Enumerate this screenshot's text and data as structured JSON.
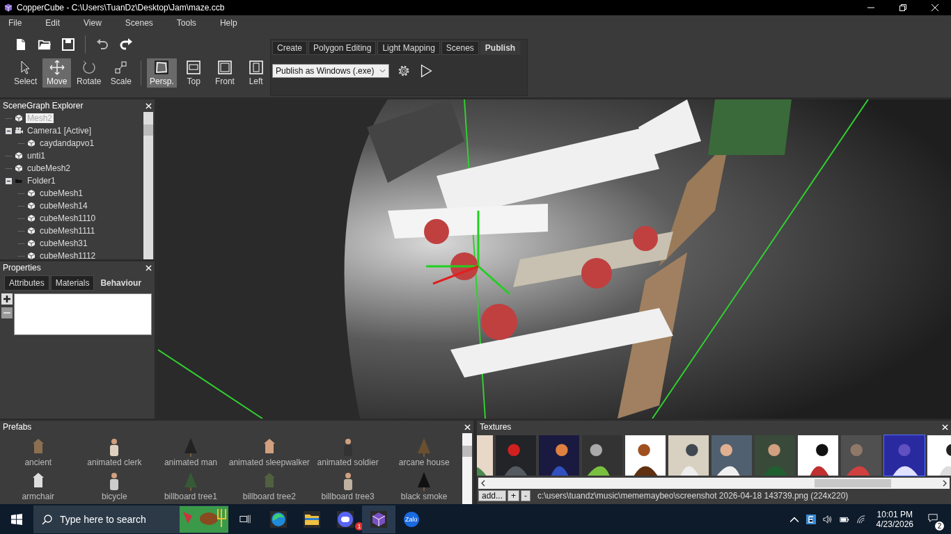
{
  "window": {
    "title": "CopperCube - C:\\Users\\TuanDz\\Desktop\\Jam\\maze.ccb"
  },
  "menu": [
    "File",
    "Edit",
    "View",
    "Scenes",
    "Tools",
    "Help"
  ],
  "tools": [
    {
      "kind": "select",
      "label": "Select",
      "selected": false
    },
    {
      "kind": "move",
      "label": "Move",
      "selected": true
    },
    {
      "kind": "rotate",
      "label": "Rotate",
      "selected": false
    },
    {
      "kind": "scale",
      "label": "Scale",
      "selected": false
    }
  ],
  "views": [
    {
      "kind": "persp",
      "label": "Persp.",
      "selected": true
    },
    {
      "kind": "top",
      "label": "Top",
      "selected": false
    },
    {
      "kind": "front",
      "label": "Front",
      "selected": false
    },
    {
      "kind": "left",
      "label": "Left",
      "selected": false
    }
  ],
  "tabs": [
    {
      "label": "Create",
      "selected": false
    },
    {
      "label": "Polygon Editing",
      "selected": false
    },
    {
      "label": "Light Mapping",
      "selected": false
    },
    {
      "label": "Scenes",
      "selected": false
    },
    {
      "label": "Publish",
      "selected": true
    }
  ],
  "publish_target": "Publish as Windows (.exe)",
  "scene_graph": {
    "title": "SceneGraph Explorer",
    "items": [
      {
        "kind": "mesh",
        "label": "Mesh2",
        "selected": true
      },
      {
        "kind": "camera",
        "label": "Camera1 [Active]",
        "selected": false,
        "expanded": true,
        "children": [
          {
            "kind": "mesh",
            "label": "caydandapvo1",
            "selected": false
          }
        ]
      },
      {
        "kind": "mesh",
        "label": "unti1",
        "selected": false
      },
      {
        "kind": "mesh",
        "label": "cubeMesh2",
        "selected": false
      },
      {
        "kind": "folder",
        "label": "Folder1",
        "selected": false,
        "expanded": true,
        "children": [
          {
            "kind": "mesh",
            "label": "cubeMesh1",
            "selected": false
          },
          {
            "kind": "mesh",
            "label": "cubeMesh14",
            "selected": false
          },
          {
            "kind": "mesh",
            "label": "cubeMesh1110",
            "selected": false
          },
          {
            "kind": "mesh",
            "label": "cubeMesh1111",
            "selected": false
          },
          {
            "kind": "mesh",
            "label": "cubeMesh31",
            "selected": false
          },
          {
            "kind": "mesh",
            "label": "cubeMesh1112",
            "selected": false
          }
        ]
      }
    ]
  },
  "properties": {
    "title": "Properties",
    "tabs": [
      {
        "label": "Attributes",
        "selected": false
      },
      {
        "label": "Materials",
        "selected": false
      },
      {
        "label": "Behaviour",
        "selected": true
      }
    ]
  },
  "prefabs": {
    "title": "Prefabs",
    "items": [
      "ancient",
      "animated clerk",
      "animated man",
      "animated sleepwalker",
      "animated soldier",
      "arcane house",
      "armchair",
      "bicycle",
      "billboard tree1",
      "billboard tree2",
      "billboard tree3",
      "black smoke"
    ]
  },
  "textures": {
    "title": "Textures",
    "items": [
      {
        "selected": false
      },
      {
        "selected": false
      },
      {
        "selected": false
      },
      {
        "selected": false
      },
      {
        "selected": false
      },
      {
        "selected": false
      },
      {
        "selected": false
      },
      {
        "selected": false
      },
      {
        "selected": false
      },
      {
        "selected": false
      },
      {
        "selected": true
      },
      {
        "selected": false
      }
    ],
    "add_button": "add...",
    "plus_button": "+",
    "minus_button": "-",
    "path": "c:\\users\\tuandz\\music\\mememaybeo\\screenshot 2026-04-18 143739.png (224x220)"
  },
  "taskbar": {
    "search_placeholder": "Type here to search",
    "discord_badge": "1",
    "zalo_label": "Zalo",
    "time": "10:01 PM",
    "date": "4/23/2026",
    "notifications": "2"
  }
}
